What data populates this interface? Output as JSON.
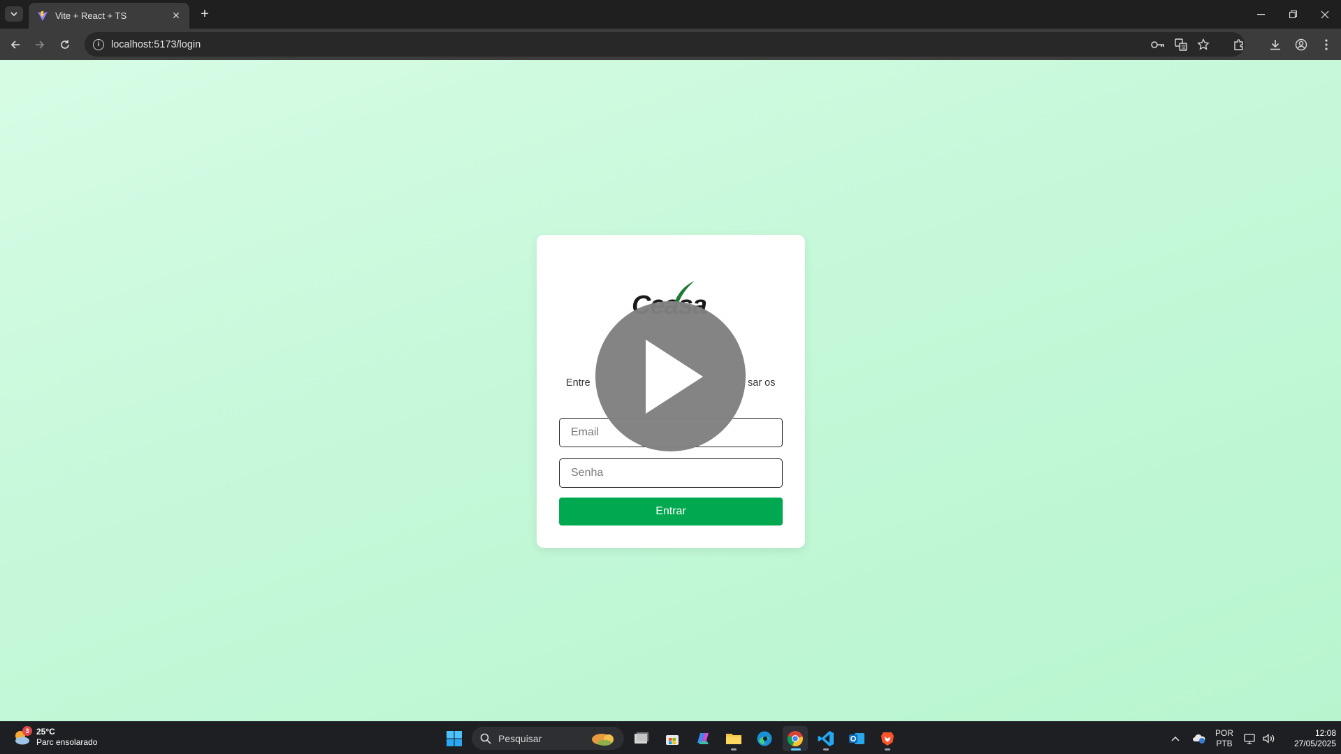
{
  "browser": {
    "tab_title": "Vite + React + TS",
    "url": "localhost:5173/login"
  },
  "page": {
    "logo_text": "Ceasa",
    "subtitle_left": "Entre",
    "subtitle_right": "sar os",
    "email_placeholder": "Email",
    "password_placeholder": "Senha",
    "login_button": "Entrar",
    "accent_color": "#00a94f"
  },
  "taskbar": {
    "weather_temp": "25°C",
    "weather_desc": "Parc ensolarado",
    "weather_badge": "3",
    "search_placeholder": "Pesquisar",
    "lang_top": "POR",
    "lang_bottom": "PTB",
    "time": "12:08",
    "date": "27/05/2025"
  }
}
